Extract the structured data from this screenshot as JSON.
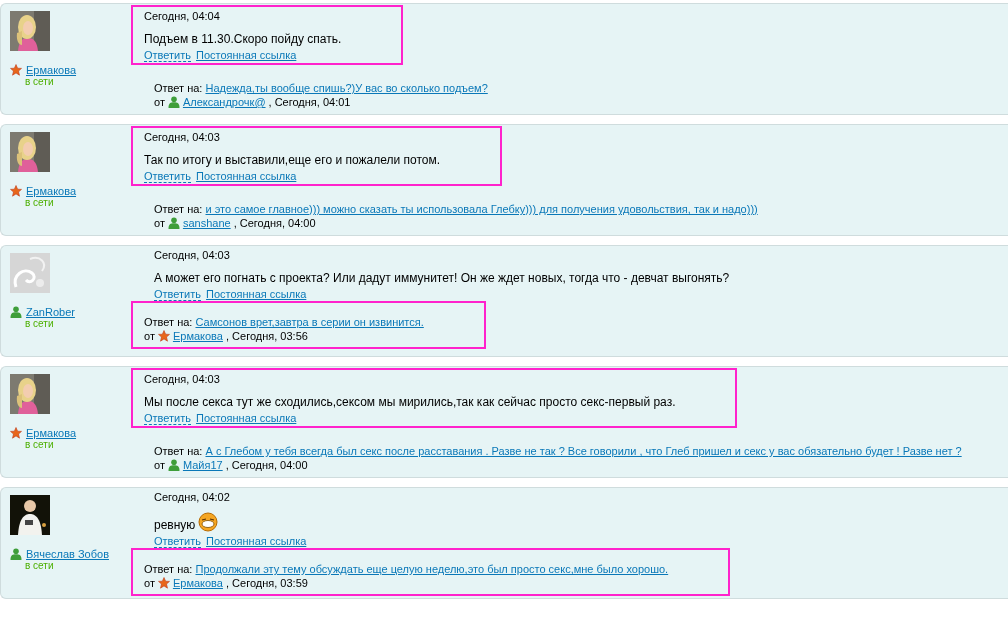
{
  "posts": [
    {
      "author": {
        "name": "Ермакова",
        "kind": "star",
        "status": "в сети"
      },
      "date": "Сегодня, 04:04",
      "message": "Подъем в 11.30.Скоро пойду спать.",
      "smiley": false,
      "actions": [
        "Ответить",
        "Постоянная ссылка"
      ],
      "message_highlighted": true,
      "reply_highlighted": false,
      "reply": {
        "label": "Ответ на:",
        "text": "Надежда,ты вообще спишь?)У вас во сколько подъем?",
        "from_label": "от",
        "from": {
          "kind": "user",
          "name": "Александрочк@",
          "time": ", Сегодня, 04:01"
        }
      }
    },
    {
      "author": {
        "name": "Ермакова",
        "kind": "star",
        "status": "в сети"
      },
      "date": "Сегодня, 04:03",
      "message": "Так по итогу и выставили,еще его и пожалели потом.",
      "smiley": false,
      "actions": [
        "Ответить",
        "Постоянная ссылка"
      ],
      "message_highlighted": true,
      "reply_highlighted": false,
      "reply": {
        "label": "Ответ на:",
        "text": "и это самое главное))) можно сказать ты использовала Глебку))) для получения удовольствия, так и надо)))",
        "from_label": "от",
        "from": {
          "kind": "user",
          "name": "sanshane",
          "time": ", Сегодня, 04:00"
        }
      }
    },
    {
      "author": {
        "name": "ZanRober",
        "kind": "user",
        "status": "в сети"
      },
      "date": "Сегодня, 04:03",
      "message": "А может его погнать с проекта? Или дадут иммунитет! Он же ждет новых, тогда что - девчат выгонять?",
      "smiley": false,
      "actions": [
        "Ответить",
        "Постоянная ссылка"
      ],
      "message_highlighted": false,
      "reply_highlighted": true,
      "reply": {
        "label": "Ответ на:",
        "text": "Самсонов врет,завтра в серии он извинится.",
        "from_label": "от",
        "from": {
          "kind": "star",
          "name": "Ермакова",
          "time": ", Сегодня, 03:56"
        }
      }
    },
    {
      "author": {
        "name": "Ермакова",
        "kind": "star",
        "status": "в сети"
      },
      "date": "Сегодня, 04:03",
      "message": "Мы после секса тут же сходились,сексом мы мирились,так как сейчас просто секс-первый раз.",
      "smiley": false,
      "actions": [
        "Ответить",
        "Постоянная ссылка"
      ],
      "message_highlighted": true,
      "reply_highlighted": false,
      "reply": {
        "label": "Ответ на:",
        "text": "А с Глебом у тебя всегда был секс после расставания . Разве не так ? Все говорили , что Глеб пришел и секс у вас обязательно будет ! Разве нет ?",
        "from_label": "от",
        "from": {
          "kind": "user",
          "name": "Майя17",
          "time": ", Сегодня, 04:00"
        }
      }
    },
    {
      "author": {
        "name": "Вячеслав Зобов",
        "kind": "user",
        "status": "в сети"
      },
      "date": "Сегодня, 04:02",
      "message": "ревную",
      "smiley": true,
      "actions": [
        "Ответить",
        "Постоянная ссылка"
      ],
      "message_highlighted": false,
      "reply_highlighted": true,
      "reply": {
        "label": "Ответ на:",
        "text": "Продолжали эту тему обсуждать еще целую неделю,это был просто секс,мне было хорошо.",
        "from_label": "от",
        "from": {
          "kind": "star",
          "name": "Ермакова",
          "time": ", Сегодня, 03:59"
        }
      }
    }
  ]
}
